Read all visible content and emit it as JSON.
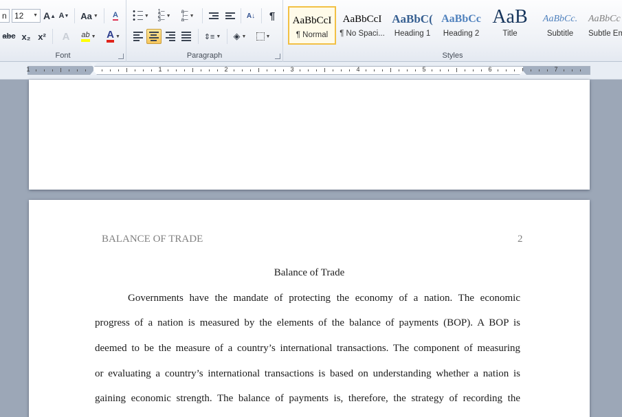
{
  "ribbon": {
    "font_group": {
      "label": "Font",
      "font_name_value": "n",
      "font_size_value": "12",
      "grow_label": "A",
      "shrink_label": "A",
      "change_case_label": "Aa",
      "strike_label": "abc",
      "subscript_label": "x₂",
      "superscript_label": "x²",
      "text_effects_label": "A",
      "highlight_label": "ab",
      "highlight_color": "#ffff00",
      "font_color_label": "A",
      "font_color": "#e0241b"
    },
    "paragraph_group": {
      "label": "Paragraph",
      "show_marks_label": "¶"
    },
    "styles_group": {
      "label": "Styles",
      "tiles": [
        {
          "sample": "AaBbCcI",
          "name": "¶ Normal",
          "active": true
        },
        {
          "sample": "AaBbCcI",
          "name": "¶ No Spaci..."
        },
        {
          "sample": "AaBbC(",
          "name": "Heading 1"
        },
        {
          "sample": "AaBbCc",
          "name": "Heading 2"
        },
        {
          "sample": "AaB",
          "name": "Title"
        },
        {
          "sample": "AaBbCc.",
          "name": "Subtitle"
        },
        {
          "sample": "AaBbCc",
          "name": "Subtle Em"
        }
      ]
    }
  },
  "ruler": {
    "numbers": [
      "1",
      "1",
      "2",
      "3",
      "4",
      "5",
      "6",
      "7"
    ]
  },
  "document": {
    "running_head": "BALANCE OF TRADE",
    "page_number": "2",
    "title": "Balance of Trade",
    "lines": [
      "Governments have the mandate of protecting the economy of a nation. The economic",
      "progress of a nation is measured by the elements of the balance of payments (BOP). A BOP is",
      "deemed to be the measure of a country’s international transactions. The component of measuring",
      "or evaluating a country’s international transactions is based on understanding whether a nation is",
      "gaining economic strength. The balance of payments is, therefore, the strategy of recording the"
    ]
  },
  "colors": {
    "accent_selected": "#f6c65c",
    "workspace": "#9ca7b7"
  }
}
